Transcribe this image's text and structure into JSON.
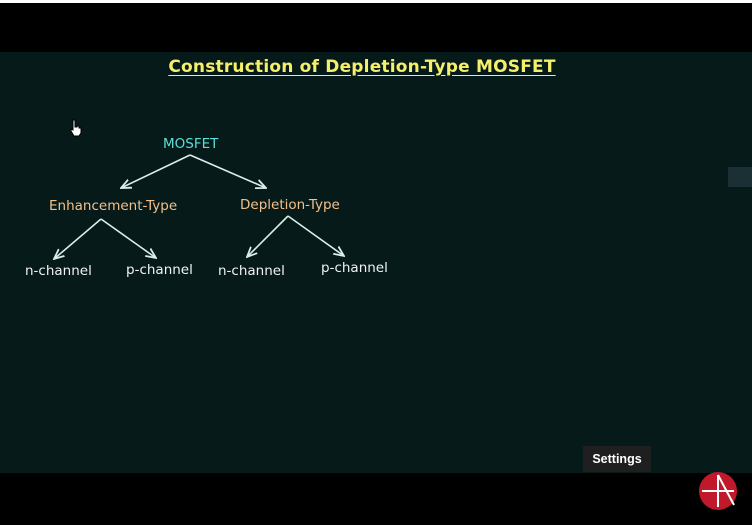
{
  "video": {
    "title": "Construction of Depletion-Type MOSFET",
    "tree": {
      "root": "MOSFET",
      "enhancement": "Enhancement-Type",
      "depletion": "Depletion-Type",
      "enh_n": "n-channel",
      "enh_p": "p-channel",
      "dep_n": "n-channel",
      "dep_p": "p-channel"
    }
  },
  "player": {
    "settings_tooltip": "Settings"
  },
  "colors": {
    "background": "#061a1a",
    "title": "#f5ef6a",
    "root": "#58e1d6",
    "mid": "#f3c08a",
    "leaf": "#f2f2f2",
    "logo": "#c0192c"
  },
  "icons": [
    "hand-pointer-cursor-icon",
    "channel-logo-icon"
  ]
}
